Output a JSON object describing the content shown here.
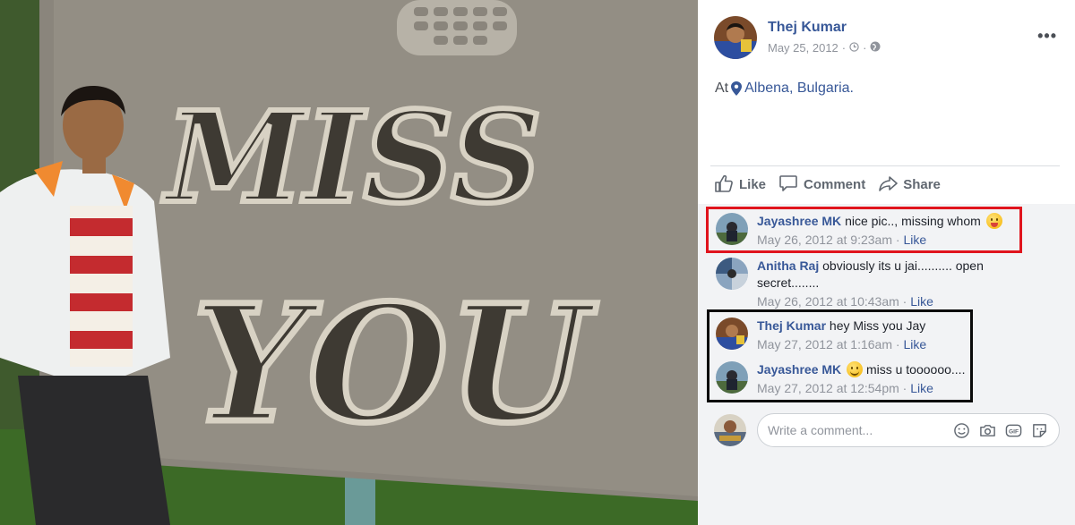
{
  "post": {
    "author": "Thej Kumar",
    "date": "May 25, 2012",
    "meta_separator": "·",
    "more_label": "•••",
    "location_prefix": "At",
    "location": "Albena, Bulgaria."
  },
  "photo": {
    "sign_text_line1": "MISS",
    "sign_text_line2": "YOU"
  },
  "actions": {
    "like": "Like",
    "comment": "Comment",
    "share": "Share"
  },
  "comments": [
    {
      "author": "Jayashree MK",
      "text": "nice pic.., missing whom",
      "emoji": "tongue-emoji",
      "time": "May 26, 2012 at 9:23am",
      "like": "Like"
    },
    {
      "author": "Anitha Raj",
      "text": "obviously its u jai.......... open secret........",
      "time": "May 26, 2012 at 10:43am",
      "like": "Like"
    },
    {
      "author": "Thej Kumar",
      "text": "hey Miss you Jay",
      "time": "May 27, 2012 at 1:16am",
      "like": "Like"
    },
    {
      "author": "Jayashree MK",
      "text": "miss u toooooo....",
      "emoji": "smile-emoji",
      "time": "May 27, 2012 at 12:54pm",
      "like": "Like"
    }
  ],
  "composer": {
    "placeholder": "Write a comment...",
    "icons": [
      "emoji-icon",
      "camera-icon",
      "gif-icon",
      "sticker-icon"
    ]
  },
  "colors": {
    "link_blue": "#385898",
    "highlight_red": "#e0141d",
    "highlight_black": "#0b0b0b",
    "comment_bg": "#f2f3f5"
  }
}
